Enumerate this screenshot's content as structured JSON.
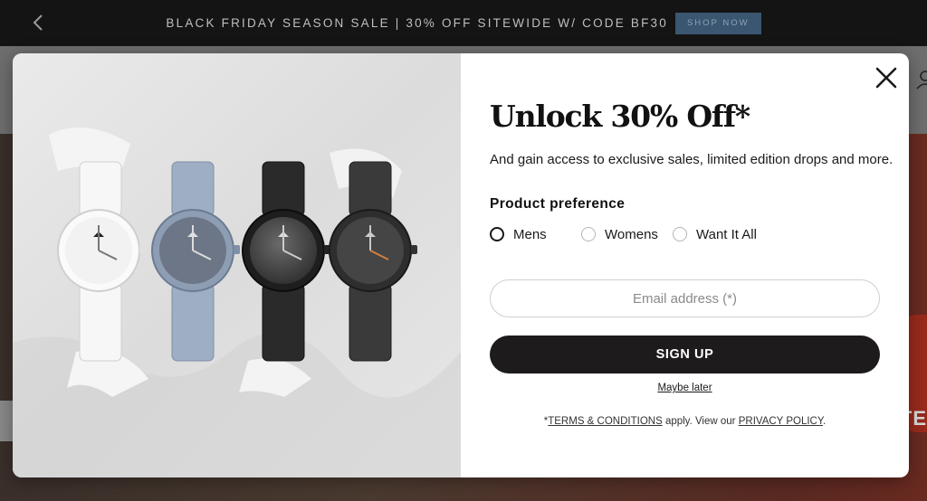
{
  "promo": {
    "text": "BLACK FRIDAY SEASON SALE | 30% OFF SITEWIDE W/ CODE BF30",
    "shop_label": "SHOP NOW"
  },
  "header": {
    "account_icon": "person-icon"
  },
  "background": {
    "hero_text_fragment": "TE"
  },
  "popup": {
    "title": "Unlock 30% Off*",
    "subtitle": "And gain access to exclusive sales, limited edition drops and more.",
    "preference_label": "Product preference",
    "options": [
      {
        "label": "Mens",
        "selected": true
      },
      {
        "label": "Womens",
        "selected": false
      },
      {
        "label": "Want It All",
        "selected": false
      }
    ],
    "email_placeholder": "Email address (*)",
    "signup_label": "SIGN UP",
    "maybe_later": "Maybe later",
    "legal": {
      "prefix": "*",
      "terms": "TERMS & CONDITIONS",
      "middle": " apply. View our ",
      "privacy": "PRIVACY POLICY",
      "suffix": "."
    },
    "image_alt_icons": [
      "watch-icon",
      "watch-icon",
      "watch-icon",
      "watch-icon"
    ]
  },
  "colors": {
    "promo_bg": "#141414",
    "shop_button": "#3a5670",
    "signup_button": "#1e1b1c"
  }
}
